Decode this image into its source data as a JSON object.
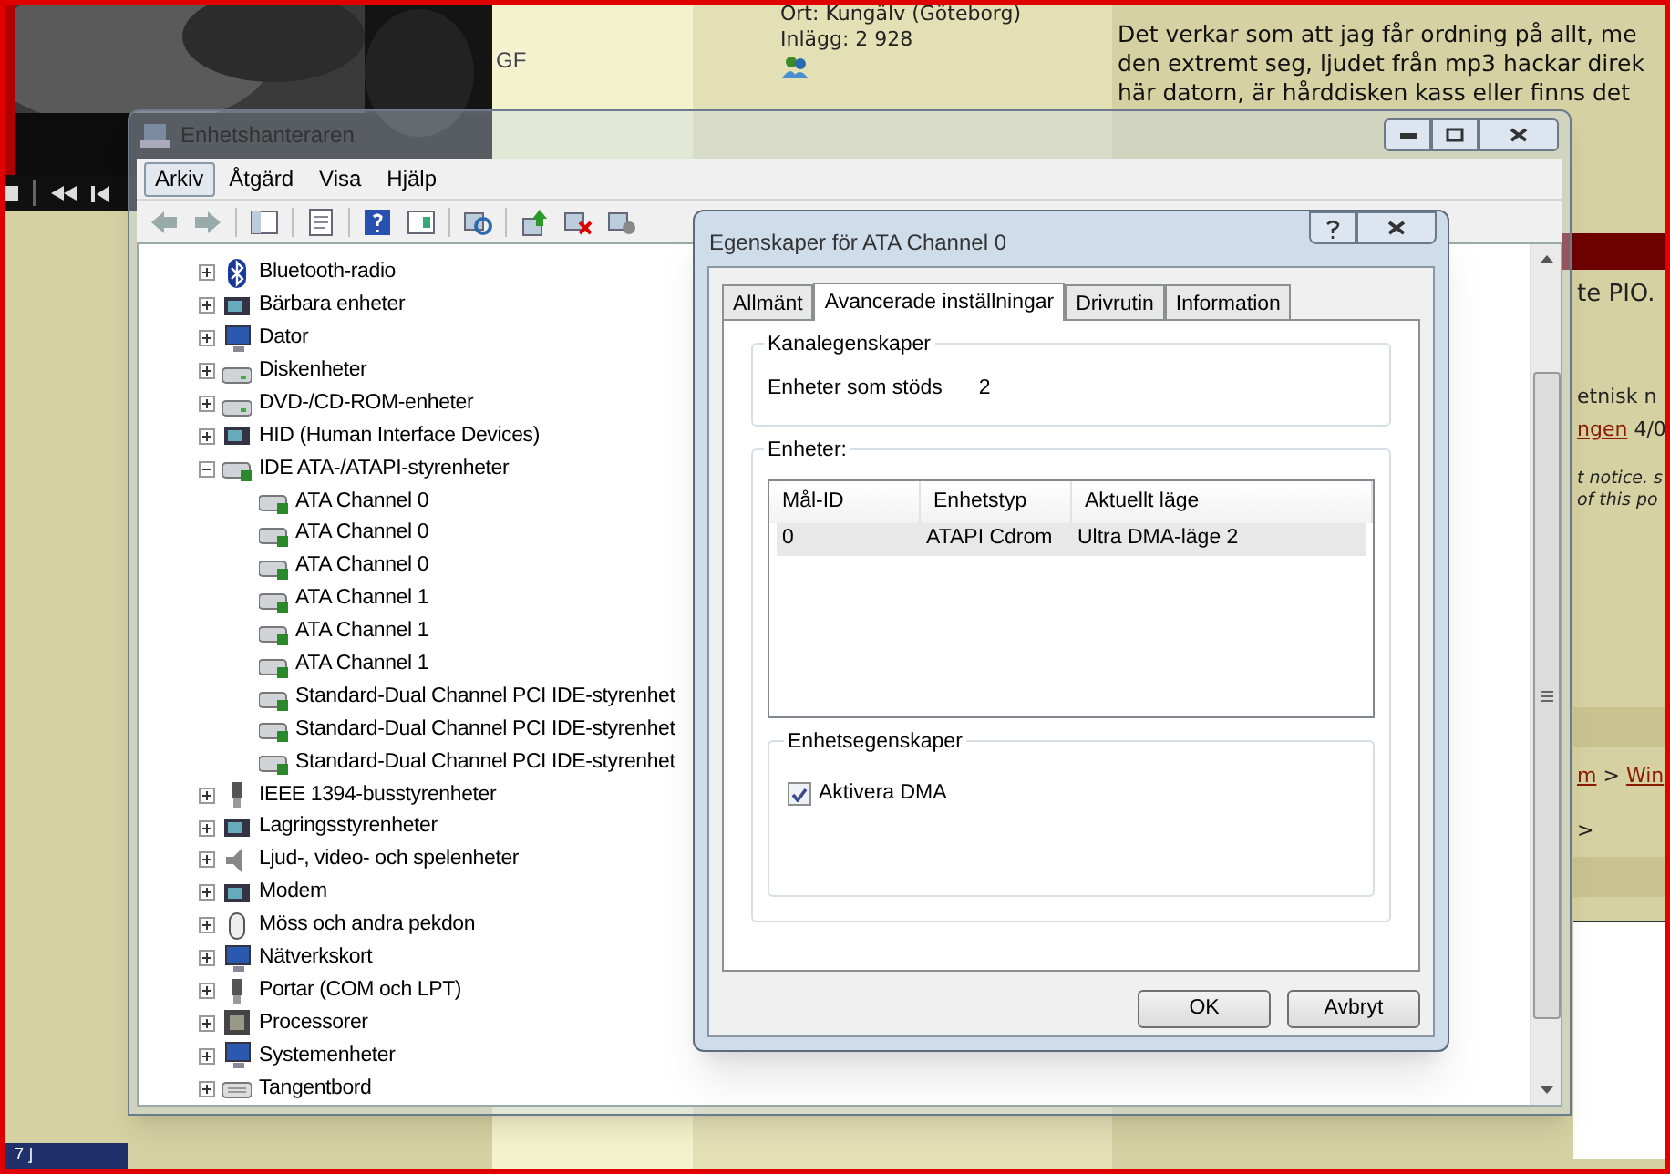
{
  "player": {
    "caption": "GF"
  },
  "taskbar_fragment": "7 ]",
  "forum": {
    "profile_lines": [
      "Ort: Kungälv (Göteborg)",
      "Inlägg: 2 928"
    ],
    "post_lines": [
      "Det verkar som att jag får ordning på allt, me",
      "den extremt seg, ljudet från mp3 hackar direk",
      "här datorn, är hårddisken kass eller finns det"
    ],
    "fragments": [
      {
        "kind": "normal",
        "segments": [
          {
            "text": "te PIO."
          }
        ]
      },
      {
        "kind": "small",
        "segments": [
          {
            "text": "etnisk n"
          }
        ]
      },
      {
        "kind": "small",
        "segments": [
          {
            "text": "ngen",
            "link": true
          },
          {
            "text": " 4/0",
            "link": false
          }
        ]
      },
      {
        "kind": "italic",
        "segments": [
          {
            "text": "t notice. s"
          }
        ]
      },
      {
        "kind": "italic",
        "segments": [
          {
            "text": "of this po"
          }
        ]
      },
      {
        "kind": "small",
        "segments": [
          {
            "text": "m",
            "link": true
          },
          {
            "text": " > ",
            "link": false
          },
          {
            "text": "Win",
            "link": true
          }
        ]
      },
      {
        "kind": "small",
        "segments": [
          {
            "text": ">"
          }
        ]
      }
    ]
  },
  "device_manager": {
    "title": "Enhetshanteraren",
    "menu": [
      {
        "label": "Arkiv",
        "selected": true
      },
      {
        "label": "Åtgärd",
        "selected": false
      },
      {
        "label": "Visa",
        "selected": false
      },
      {
        "label": "Hjälp",
        "selected": false
      }
    ],
    "tree": [
      {
        "label": "Bluetooth-radio",
        "kind": "bluetooth",
        "expanded": false
      },
      {
        "label": "Bärbara enheter",
        "kind": "device",
        "expanded": false
      },
      {
        "label": "Dator",
        "kind": "computer",
        "expanded": false
      },
      {
        "label": "Diskenheter",
        "kind": "drive",
        "expanded": false
      },
      {
        "label": "DVD-/CD-ROM-enheter",
        "kind": "drive",
        "expanded": false
      },
      {
        "label": "HID (Human Interface Devices)",
        "kind": "device",
        "expanded": false
      },
      {
        "label": "IDE ATA-/ATAPI-styrenheter",
        "kind": "controller",
        "expanded": true,
        "children": [
          {
            "label": "ATA Channel 0",
            "kind": "controller"
          },
          {
            "label": "ATA Channel 0",
            "kind": "controller"
          },
          {
            "label": "ATA Channel 0",
            "kind": "controller"
          },
          {
            "label": "ATA Channel 1",
            "kind": "controller"
          },
          {
            "label": "ATA Channel 1",
            "kind": "controller"
          },
          {
            "label": "ATA Channel 1",
            "kind": "controller"
          },
          {
            "label": "Standard-Dual Channel PCI IDE-styrenhet",
            "kind": "controller"
          },
          {
            "label": "Standard-Dual Channel PCI IDE-styrenhet",
            "kind": "controller"
          },
          {
            "label": "Standard-Dual Channel PCI IDE-styrenhet",
            "kind": "controller"
          }
        ]
      },
      {
        "label": "IEEE 1394-busstyrenheter",
        "kind": "plug",
        "expanded": false
      },
      {
        "label": "Lagringsstyrenheter",
        "kind": "device",
        "expanded": false
      },
      {
        "label": "Ljud-, video- och spelenheter",
        "kind": "speaker",
        "expanded": false
      },
      {
        "label": "Modem",
        "kind": "device",
        "expanded": false
      },
      {
        "label": "Möss och andra pekdon",
        "kind": "mouse",
        "expanded": false
      },
      {
        "label": "Nätverkskort",
        "kind": "computer",
        "expanded": false
      },
      {
        "label": "Portar (COM och LPT)",
        "kind": "plug",
        "expanded": false
      },
      {
        "label": "Processorer",
        "kind": "chip",
        "expanded": false
      },
      {
        "label": "Systemenheter",
        "kind": "computer",
        "expanded": false
      },
      {
        "label": "Tangentbord",
        "kind": "keyboard",
        "expanded": false
      }
    ]
  },
  "dialog": {
    "title": "Egenskaper för ATA Channel 0",
    "tabs": [
      {
        "label": "Allmänt",
        "selected": false
      },
      {
        "label": "Avancerade inställningar",
        "selected": true
      },
      {
        "label": "Drivrutin",
        "selected": false
      },
      {
        "label": "Information",
        "selected": false
      }
    ],
    "channel_group": {
      "title": "Kanalegenskaper",
      "label": "Enheter som stöds",
      "value": "2"
    },
    "devices_group": {
      "title": "Enheter:",
      "columns": [
        "Mål-ID",
        "Enhetstyp",
        "Aktuellt läge"
      ],
      "rows": [
        {
          "cells": [
            "0",
            "ATAPI Cdrom",
            "Ultra DMA-läge 2"
          ],
          "selected": true
        }
      ]
    },
    "device_props_group": {
      "title": "Enhetsegenskaper",
      "checkbox": {
        "label": "Aktivera DMA",
        "checked": true
      }
    },
    "buttons": [
      "OK",
      "Avbryt"
    ]
  }
}
